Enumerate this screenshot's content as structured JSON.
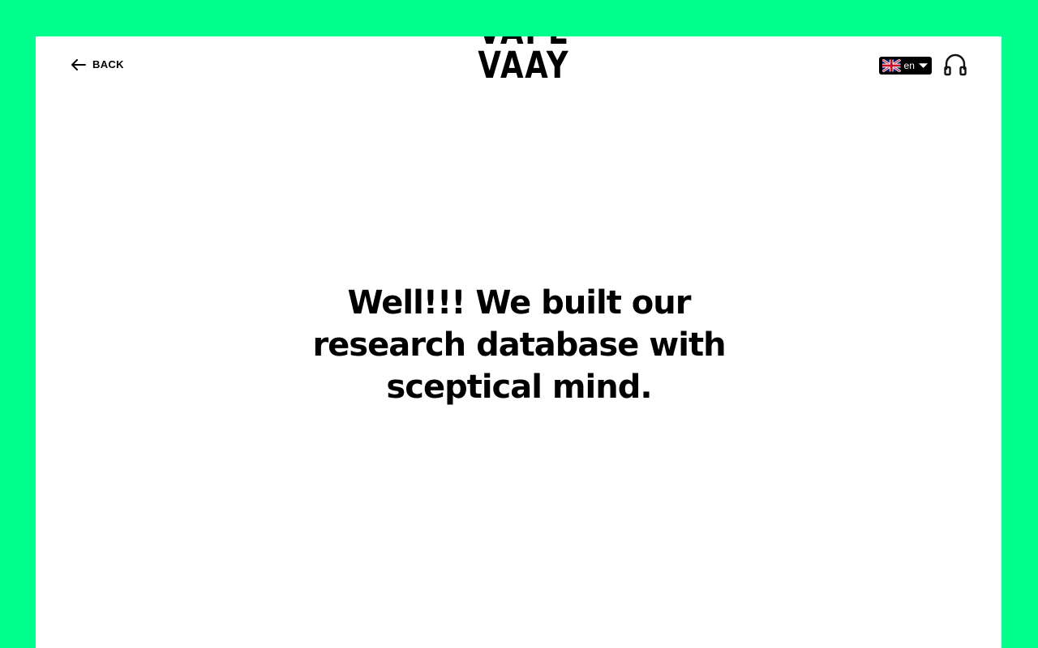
{
  "header": {
    "back_label": "BACK",
    "logo": {
      "line1": "VAPE",
      "line2": "VAAY"
    },
    "language": {
      "code": "en",
      "flag_icon": "uk-flag-icon"
    },
    "audio_icon": "headphones-icon"
  },
  "main": {
    "headline": "Well!!! We built our research database with sceptical mind."
  },
  "colors": {
    "background": "#00ff8c",
    "panel": "#ffffff",
    "text": "#000000"
  }
}
